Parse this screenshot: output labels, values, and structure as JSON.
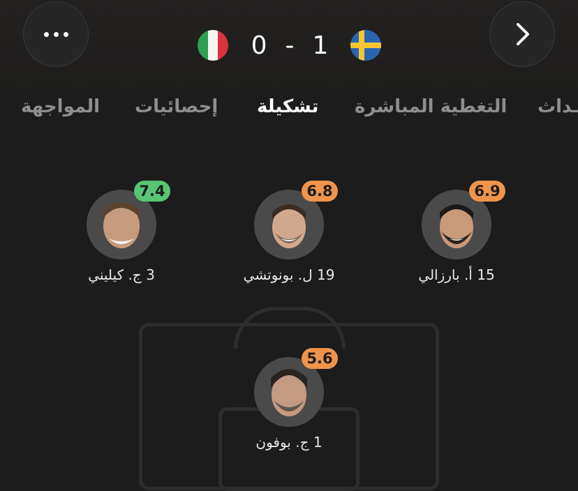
{
  "match": {
    "home_score": "0",
    "separator": "-",
    "away_score": "1",
    "home_team_flag": "italy-flag",
    "away_team_flag": "sweden-flag"
  },
  "header": {
    "more_icon": "more-icon",
    "next_icon": "chevron-right-icon"
  },
  "tabs": [
    {
      "label": "المواجهة",
      "active": false
    },
    {
      "label": "إحصائيات",
      "active": false
    },
    {
      "label": "تشكيلة",
      "active": true
    },
    {
      "label": "التغطية المباشرة",
      "active": false
    },
    {
      "label": "ـداث",
      "active": false
    }
  ],
  "players": [
    {
      "name": "3 ج. كيليني",
      "rating": "7.4",
      "rating_color": "#57c575"
    },
    {
      "name": "19 ل. بونوتشي",
      "rating": "6.8",
      "rating_color": "#f0944b"
    },
    {
      "name": "15 أ. بارزالي",
      "rating": "6.9",
      "rating_color": "#f0944b"
    },
    {
      "name": "1 ج. بوفون",
      "rating": "5.6",
      "rating_color": "#f0944b"
    }
  ],
  "colors": {
    "background": "#1c1c1c",
    "rating_good": "#57c575",
    "rating_average": "#f0944b",
    "tab_inactive": "#8e8e8e",
    "tab_active": "#ffffff"
  }
}
